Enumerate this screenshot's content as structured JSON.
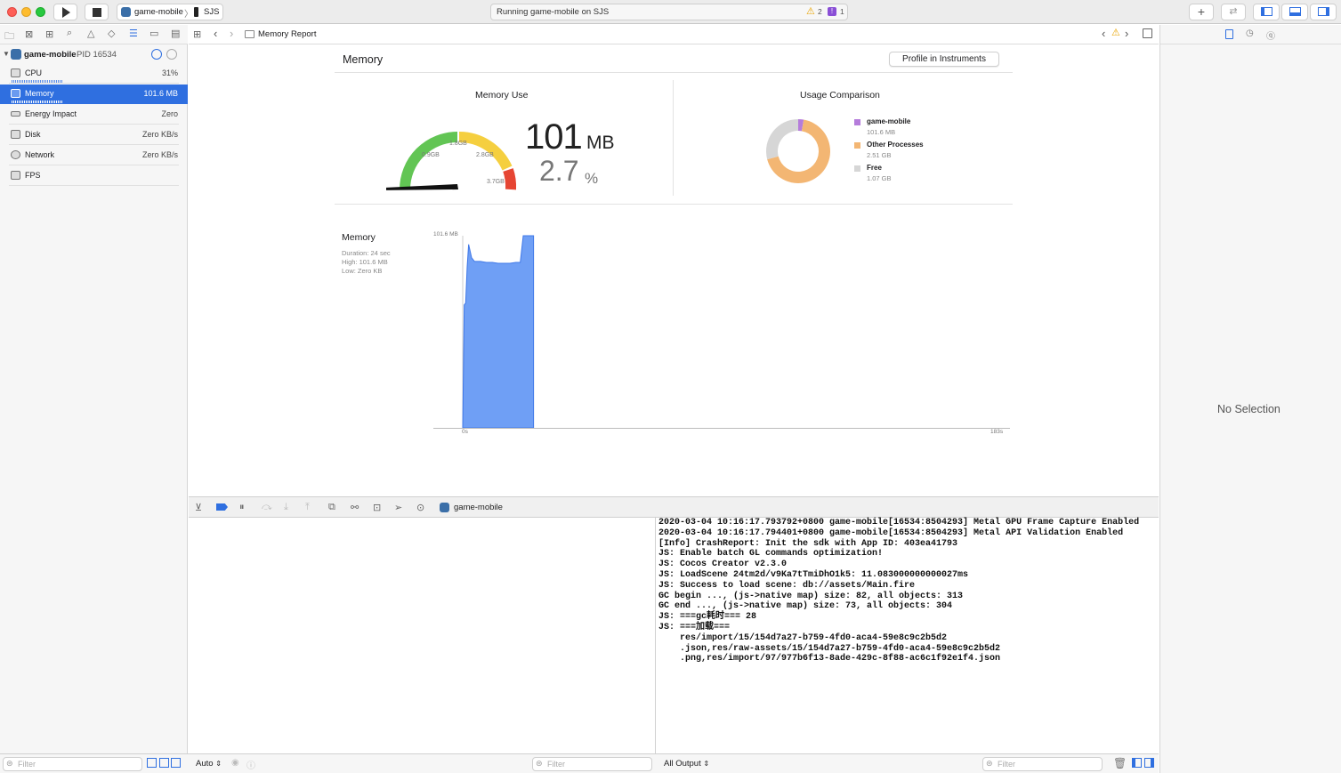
{
  "toolbar": {
    "scheme": "game-mobile",
    "destination": "SJS",
    "activity": "Running game-mobile on SJS",
    "warnings": "2",
    "issues": "1"
  },
  "sidebar": {
    "process_name": "game-mobile",
    "process_pid": "PID 16534",
    "gauges": [
      {
        "label": "CPU",
        "value": "31%"
      },
      {
        "label": "Memory",
        "value": "101.6 MB"
      },
      {
        "label": "Energy Impact",
        "value": "Zero"
      },
      {
        "label": "Disk",
        "value": "Zero KB/s"
      },
      {
        "label": "Network",
        "value": "Zero KB/s"
      },
      {
        "label": "FPS",
        "value": ""
      }
    ],
    "filter_placeholder": "Filter"
  },
  "jumpbar": {
    "title": "Memory Report"
  },
  "report": {
    "title": "Memory",
    "profile_button": "Profile in Instruments",
    "memory_use": {
      "title": "Memory Use",
      "value": "101",
      "unit": "MB",
      "percent": "2.7",
      "percent_unit": "%",
      "fraction": 0.027,
      "ticks": [
        "0.9GB",
        "1.8GB",
        "2.8GB",
        "3.7GB"
      ]
    },
    "usage_comparison": {
      "title": "Usage Comparison",
      "legend": [
        {
          "name": "game-mobile",
          "value": "101.6 MB",
          "color": "#b57cdb",
          "gb": 0.1016
        },
        {
          "name": "Other Processes",
          "value": "2.51 GB",
          "color": "#f3b673",
          "gb": 2.51
        },
        {
          "name": "Free",
          "value": "1.07 GB",
          "color": "#d6d6d6",
          "gb": 1.07
        }
      ]
    },
    "graph": {
      "title": "Memory",
      "duration": "Duration: 24 sec",
      "high": "High: 101.6 MB",
      "low": "Low: Zero KB",
      "ymax_label": "101.6 MB",
      "x_start": "0s",
      "x_end": "183s"
    }
  },
  "chart_data": {
    "type": "area",
    "title": "Memory",
    "xlabel": "",
    "ylabel": "",
    "xlim": [
      0,
      183
    ],
    "ylim": [
      0,
      101.6
    ],
    "x": [
      0,
      0.5,
      1,
      1.5,
      2,
      3,
      4,
      6,
      8,
      10,
      12,
      14,
      16,
      18,
      19.5,
      20.5,
      22,
      24
    ],
    "values": [
      0,
      65,
      66,
      85,
      97,
      90,
      88,
      88,
      87.5,
      87.5,
      87,
      87,
      87,
      87.5,
      87.5,
      101.6,
      101.6,
      101.6
    ]
  },
  "debug": {
    "target": "game-mobile",
    "auto_label": "Auto",
    "output_label": "All Output",
    "filter_placeholder": "Filter"
  },
  "console": {
    "lines": [
      "2020-03-04 10:16:17.793792+0800 game-mobile[16534:8504293] Metal GPU Frame Capture Enabled",
      "2020-03-04 10:16:17.794401+0800 game-mobile[16534:8504293] Metal API Validation Enabled",
      "[Info] CrashReport: Init the sdk with App ID: 403ea41793",
      "JS: Enable batch GL commands optimization!",
      "JS: Cocos Creator v2.3.0",
      "JS: LoadScene 24tm2d/v9Ka7tTmiDhO1k5: 11.083000000000027ms",
      "JS: Success to load scene: db://assets/Main.fire",
      "GC begin ..., (js->native map) size: 82, all objects: 313",
      "GC end ..., (js->native map) size: 73, all objects: 304",
      "JS: ===gc耗时=== 28",
      "JS: ===加载===",
      "    res/import/15/154d7a27-b759-4fd0-aca4-59e8c9c2b5d2",
      "    .json,res/raw-assets/15/154d7a27-b759-4fd0-aca4-59e8c9c2b5d2",
      "    .png,res/import/97/977b6f13-8ade-429c-8f88-ac6c1f92e1f4.json"
    ]
  },
  "inspector": {
    "empty": "No Selection"
  },
  "colors": {
    "accent": "#2f6fe0",
    "graph_fill": "#6f9ff5",
    "gauge_green": "#62c554",
    "gauge_yellow": "#f5cf3f",
    "gauge_red": "#e64533"
  }
}
